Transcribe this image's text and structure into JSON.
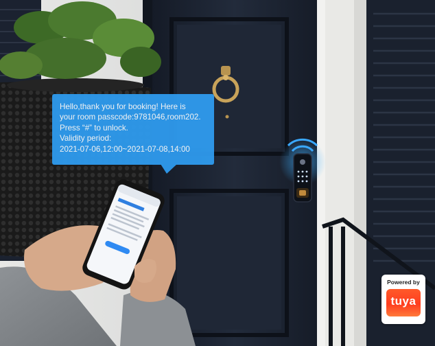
{
  "message": {
    "lines": [
      "Hello,thank you for booking! Here is",
      "your room passcode:9781046,room202.",
      "Press “#” to unlock.",
      "Validity period:",
      "2021-07-06,12:00~2021-07-08,14:00"
    ]
  },
  "badge": {
    "powered_by": "Powered by",
    "brand": "tuya"
  },
  "colors": {
    "bubble": "#2f9cf0",
    "door": "#1c2331",
    "brand": "#ff4a22"
  }
}
